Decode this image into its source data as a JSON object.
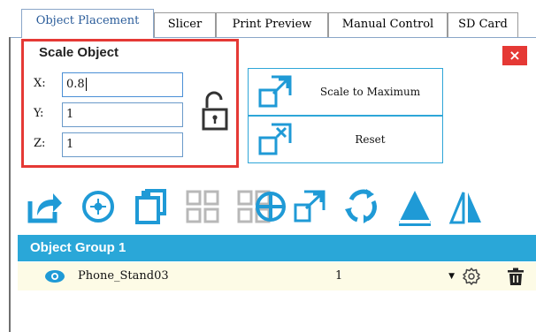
{
  "tabs": [
    {
      "label": "Object Placement",
      "active": true
    },
    {
      "label": "Slicer",
      "active": false
    },
    {
      "label": "Print Preview",
      "active": false
    },
    {
      "label": "Manual Control",
      "active": false
    },
    {
      "label": "SD Card",
      "active": false
    }
  ],
  "scale": {
    "title": "Scale Object",
    "x_label": "X:",
    "y_label": "Y:",
    "z_label": "Z:",
    "x_value": "0.8",
    "y_value": "1",
    "z_value": "1",
    "lock_icon": "unlocked-padlock-icon"
  },
  "actions": {
    "scale_max_label": "Scale to Maximum",
    "reset_label": "Reset"
  },
  "close_label": "×",
  "toolbar_icons": [
    "export-icon",
    "add-object-icon",
    "copy-object-icon",
    "grid-layout-icon",
    "center-object-icon",
    "scale-icon",
    "rotate-icon",
    "flatten-icon",
    "mirror-icon"
  ],
  "object_group": {
    "title": "Object Group 1",
    "objects": [
      {
        "name": "Phone_Stand03",
        "quantity": "1"
      }
    ]
  },
  "colors": {
    "accent": "#2aa7d8",
    "highlight": "#e53935",
    "row_bg": "#fdfbe6"
  }
}
